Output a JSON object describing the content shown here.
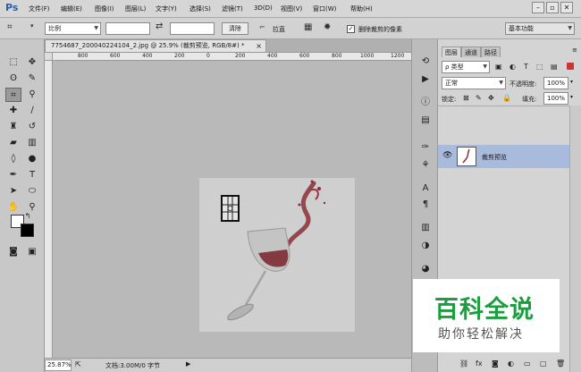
{
  "app": {
    "logo": "Ps"
  },
  "menu": [
    "文件(F)",
    "编辑(E)",
    "图像(I)",
    "图层(L)",
    "文字(Y)",
    "选择(S)",
    "滤镜(T)",
    "3D(D)",
    "视图(V)",
    "窗口(W)",
    "帮助(H)"
  ],
  "window_buttons": {
    "minimize": "–",
    "restore": "▫",
    "close": "✕"
  },
  "options": {
    "ratio_select": "比例",
    "swap_icon": "⇄",
    "clear_button": "清除",
    "straighten_button": "拉直",
    "delete_cropped_label": "删除裁剪的像素",
    "delete_cropped_checked": "✓",
    "workspace_select": "基本功能"
  },
  "document": {
    "tab_title": "7754687_200040224104_2.jpg @ 25.9% (裁剪预览, RGB/8#) *",
    "close": "×",
    "ruler_ticks": [
      "800",
      "600",
      "400",
      "200",
      "0",
      "200",
      "400",
      "600",
      "800",
      "1000",
      "1200"
    ]
  },
  "status": {
    "zoom": "25.87%",
    "doc_info": "文档:3.00M/0 字节"
  },
  "panels": {
    "tabs": [
      "图层",
      "通道",
      "路径"
    ],
    "kind_filter": "ρ 类型",
    "blend_mode": "正常",
    "opacity_label": "不透明度:",
    "opacity_value": "100%",
    "lock_label": "锁定:",
    "fill_label": "填充:",
    "fill_value": "100%",
    "layer_name": "裁剪预览"
  },
  "watermark": {
    "title": "百科全说",
    "subtitle": "助你轻松解决"
  },
  "colors": {
    "accent_green": "#1a9f3e",
    "layer_selected": "#a9bbdc"
  }
}
